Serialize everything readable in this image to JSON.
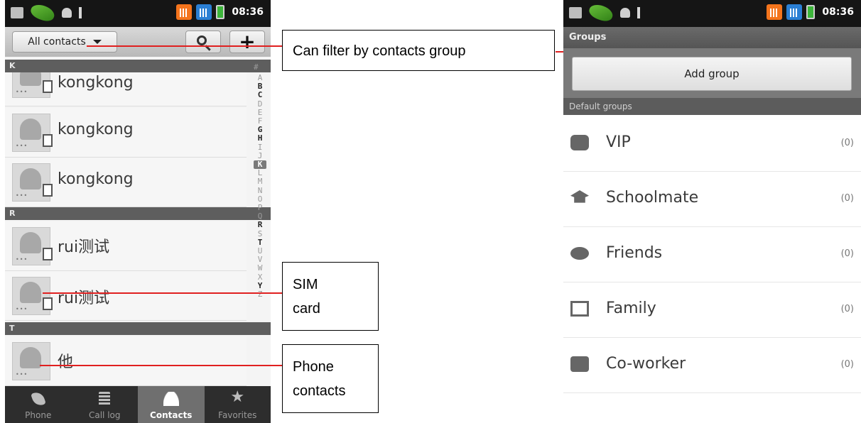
{
  "status_bar": {
    "time": "08:36"
  },
  "contacts_screen": {
    "filter_label": "All contacts",
    "sections": [
      {
        "letter": "K",
        "rows": [
          {
            "name": "kongkong"
          },
          {
            "name": "kongkong"
          },
          {
            "name": "kongkong"
          }
        ]
      },
      {
        "letter": "R",
        "rows": [
          {
            "name": "rui测试"
          },
          {
            "name": "rui测试"
          }
        ]
      },
      {
        "letter": "T",
        "rows": [
          {
            "name": "他"
          }
        ]
      }
    ],
    "index_top": "#",
    "alphabet": [
      "A",
      "B",
      "C",
      "D",
      "E",
      "F",
      "G",
      "H",
      "I",
      "J",
      "K",
      "L",
      "M",
      "N",
      "O",
      "P",
      "Q",
      "R",
      "S",
      "T",
      "U",
      "V",
      "W",
      "X",
      "Y",
      "Z"
    ],
    "tabs": [
      {
        "label": "Phone",
        "icon": "phone-icon"
      },
      {
        "label": "Call log",
        "icon": "call-log-icon"
      },
      {
        "label": "Contacts",
        "icon": "contacts-icon"
      },
      {
        "label": "Favorites",
        "icon": "star-icon"
      }
    ]
  },
  "callouts": {
    "filter": "Can filter by contacts group",
    "sim": [
      "SIM",
      "card"
    ],
    "phone": [
      "Phone",
      "contacts"
    ]
  },
  "groups_screen": {
    "title": "Groups",
    "add_group_label": "Add group",
    "default_groups_header": "Default groups",
    "groups": [
      {
        "name": "VIP",
        "count": "(0)",
        "icon": "vip-badge-icon"
      },
      {
        "name": "Schoolmate",
        "count": "(0)",
        "icon": "graduation-cap-icon"
      },
      {
        "name": "Friends",
        "count": "(0)",
        "icon": "friends-cup-icon"
      },
      {
        "name": "Family",
        "count": "(0)",
        "icon": "family-portrait-icon"
      },
      {
        "name": "Co-worker",
        "count": "(0)",
        "icon": "briefcase-icon"
      }
    ]
  }
}
